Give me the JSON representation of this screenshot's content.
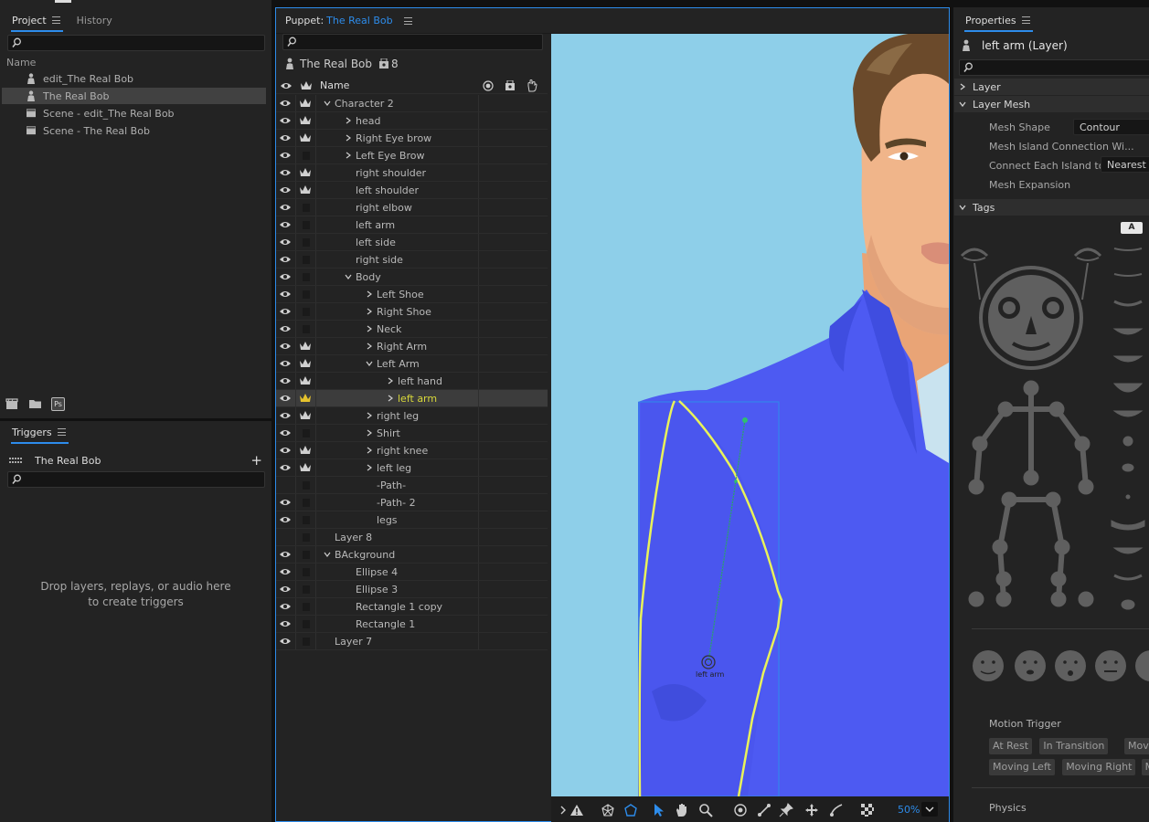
{
  "project_panel": {
    "tabs": [
      {
        "label": "Project"
      },
      {
        "label": "History"
      }
    ],
    "list_header": "Name",
    "items": [
      {
        "label": "edit_The Real Bob",
        "type": "puppet"
      },
      {
        "label": "The Real Bob",
        "type": "puppet"
      },
      {
        "label": "Scene - edit_The Real Bob",
        "type": "scene"
      },
      {
        "label": "Scene - The Real Bob",
        "type": "scene"
      }
    ],
    "footer_icons": [
      "new-scene-icon",
      "folder-icon",
      "photoshop-icon"
    ],
    "footer_ps_label": "Ps"
  },
  "triggers_panel": {
    "title": "Triggers",
    "puppet_name": "The Real Bob",
    "add_label": "+",
    "empty_line1": "Drop layers, replays, or audio here",
    "empty_line2": "to create triggers"
  },
  "puppet_panel": {
    "tab_prefix": "Puppet:",
    "tab_name": "The Real Bob",
    "puppet_name": "The Real Bob",
    "handle_count": "8",
    "column_name": "Name",
    "rows": [
      {
        "label": "Character 2",
        "indent": 0,
        "chev": "down",
        "eye": true,
        "crown": true
      },
      {
        "label": "head",
        "indent": 1,
        "chev": "right",
        "eye": true,
        "crown": true
      },
      {
        "label": "Right Eye brow",
        "indent": 1,
        "chev": "right",
        "eye": true,
        "crown": true
      },
      {
        "label": "Left Eye Brow",
        "indent": 1,
        "chev": "right",
        "eye": true,
        "crown": false
      },
      {
        "label": "right shoulder",
        "indent": 1,
        "chev": "",
        "eye": true,
        "crown": true
      },
      {
        "label": "left shoulder",
        "indent": 1,
        "chev": "",
        "eye": true,
        "crown": true
      },
      {
        "label": "right elbow",
        "indent": 1,
        "chev": "",
        "eye": true,
        "crown": false
      },
      {
        "label": "left arm",
        "indent": 1,
        "chev": "",
        "eye": true,
        "crown": false
      },
      {
        "label": "left side",
        "indent": 1,
        "chev": "",
        "eye": true,
        "crown": false
      },
      {
        "label": "right side",
        "indent": 1,
        "chev": "",
        "eye": true,
        "crown": false
      },
      {
        "label": "Body",
        "indent": 1,
        "chev": "down",
        "eye": true,
        "crown": false
      },
      {
        "label": "Left Shoe",
        "indent": 2,
        "chev": "right",
        "eye": true,
        "crown": false
      },
      {
        "label": "Right Shoe",
        "indent": 2,
        "chev": "right",
        "eye": true,
        "crown": false
      },
      {
        "label": "Neck",
        "indent": 2,
        "chev": "right",
        "eye": true,
        "crown": false
      },
      {
        "label": "Right Arm",
        "indent": 2,
        "chev": "right",
        "eye": true,
        "crown": true
      },
      {
        "label": "Left Arm",
        "indent": 2,
        "chev": "down",
        "eye": true,
        "crown": true
      },
      {
        "label": "left hand",
        "indent": 3,
        "chev": "right",
        "eye": true,
        "crown": true
      },
      {
        "label": "left arm",
        "indent": 3,
        "chev": "right",
        "eye": true,
        "crown": true,
        "selected": true
      },
      {
        "label": "right leg",
        "indent": 2,
        "chev": "right",
        "eye": true,
        "crown": true
      },
      {
        "label": "Shirt",
        "indent": 2,
        "chev": "right",
        "eye": true,
        "crown": false
      },
      {
        "label": "right knee",
        "indent": 2,
        "chev": "right",
        "eye": true,
        "crown": true
      },
      {
        "label": "left leg",
        "indent": 2,
        "chev": "right",
        "eye": true,
        "crown": true
      },
      {
        "label": "-Path-",
        "indent": 2,
        "chev": "",
        "eye": false,
        "crown": false
      },
      {
        "label": "-Path- 2",
        "indent": 2,
        "chev": "",
        "eye": true,
        "crown": false
      },
      {
        "label": "legs",
        "indent": 2,
        "chev": "",
        "eye": true,
        "crown": false
      },
      {
        "label": "Layer 8",
        "indent": 0,
        "chev": "",
        "eye": false,
        "crown": false
      },
      {
        "label": "BAckground",
        "indent": 0,
        "chev": "down",
        "eye": true,
        "crown": false
      },
      {
        "label": "Ellipse 4",
        "indent": 1,
        "chev": "",
        "eye": true,
        "crown": false
      },
      {
        "label": "Ellipse 3",
        "indent": 1,
        "chev": "",
        "eye": true,
        "crown": false
      },
      {
        "label": "Rectangle 1 copy",
        "indent": 1,
        "chev": "",
        "eye": true,
        "crown": false
      },
      {
        "label": "Rectangle 1",
        "indent": 1,
        "chev": "",
        "eye": true,
        "crown": false
      },
      {
        "label": "Layer 7",
        "indent": 0,
        "chev": "",
        "eye": true,
        "crown": false
      }
    ],
    "canvas_handle_label": "left arm",
    "zoom": "50%",
    "colors": {
      "canvas_bg": "#8ecfe9",
      "shirt": "#4d5af2",
      "skin": "#f0b58a",
      "selection": "#e9f25a",
      "accent": "#2d8ceb"
    }
  },
  "properties_panel": {
    "title": "Properties",
    "layer_title": "left arm (Layer)",
    "sections": {
      "layer": "Layer",
      "layer_mesh": "Layer Mesh",
      "tags": "Tags"
    },
    "mesh": {
      "shape_label": "Mesh Shape",
      "shape_value": "Contour",
      "island_label": "Mesh Island Connection Wi...",
      "connect_label": "Connect Each Island to",
      "connect_value": "Nearest",
      "expansion_label": "Mesh Expansion"
    },
    "tags_letter": "A",
    "motion_trigger_label": "Motion Trigger",
    "motion_chips_row1": [
      "At Rest",
      "In Transition",
      "Moving Do"
    ],
    "motion_chips_row2": [
      "Moving Left",
      "Moving Right",
      "Movi"
    ],
    "physics_label": "Physics"
  }
}
